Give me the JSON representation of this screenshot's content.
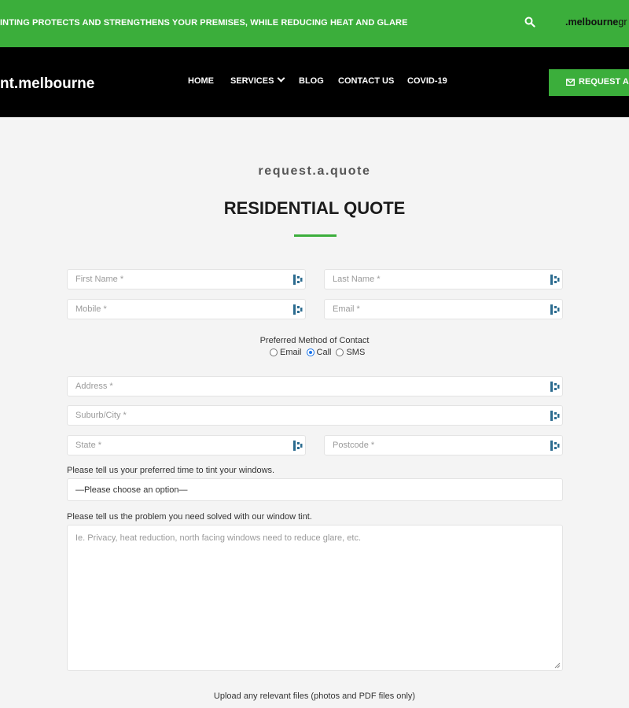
{
  "topbar": {
    "tagline": "INTING PROTECTS AND STRENGTHENS YOUR PREMISES, WHILE REDUCING HEAT AND GLARE",
    "domain_bold": ".melbourne",
    "domain_tail": "gr",
    "icon": "search-icon"
  },
  "header": {
    "logo": "nt.melbourne",
    "nav": [
      "HOME",
      "SERVICES",
      "BLOG",
      "CONTACT US",
      "COVID-19"
    ],
    "cta": "REQUEST A Q"
  },
  "main": {
    "subtitle": "request.a.quote",
    "title": "RESIDENTIAL QUOTE",
    "fields": {
      "first_name": "First Name *",
      "last_name": "Last Name *",
      "mobile": "Mobile *",
      "email": "Email *",
      "address": "Address *",
      "suburb": "Suburb/City *",
      "state": "State *",
      "postcode": "Postcode *"
    },
    "preferred_contact": {
      "label": "Preferred Method of Contact",
      "options": [
        "Email",
        "Call",
        "SMS"
      ],
      "selected": "Call"
    },
    "time_question": "Please tell us your preferred time to tint your windows.",
    "time_select_value": "—Please choose an option—",
    "problem_question": "Please tell us the problem you need solved with our window tint.",
    "problem_placeholder": "Ie. Privacy, heat reduction, north facing windows need to reduce glare, etc.",
    "upload_label": "Upload any relevant files (photos and PDF files only)"
  },
  "colors": {
    "accent": "#3bae3b",
    "nav_bg": "#000000",
    "page_bg": "#f4f4f4"
  }
}
